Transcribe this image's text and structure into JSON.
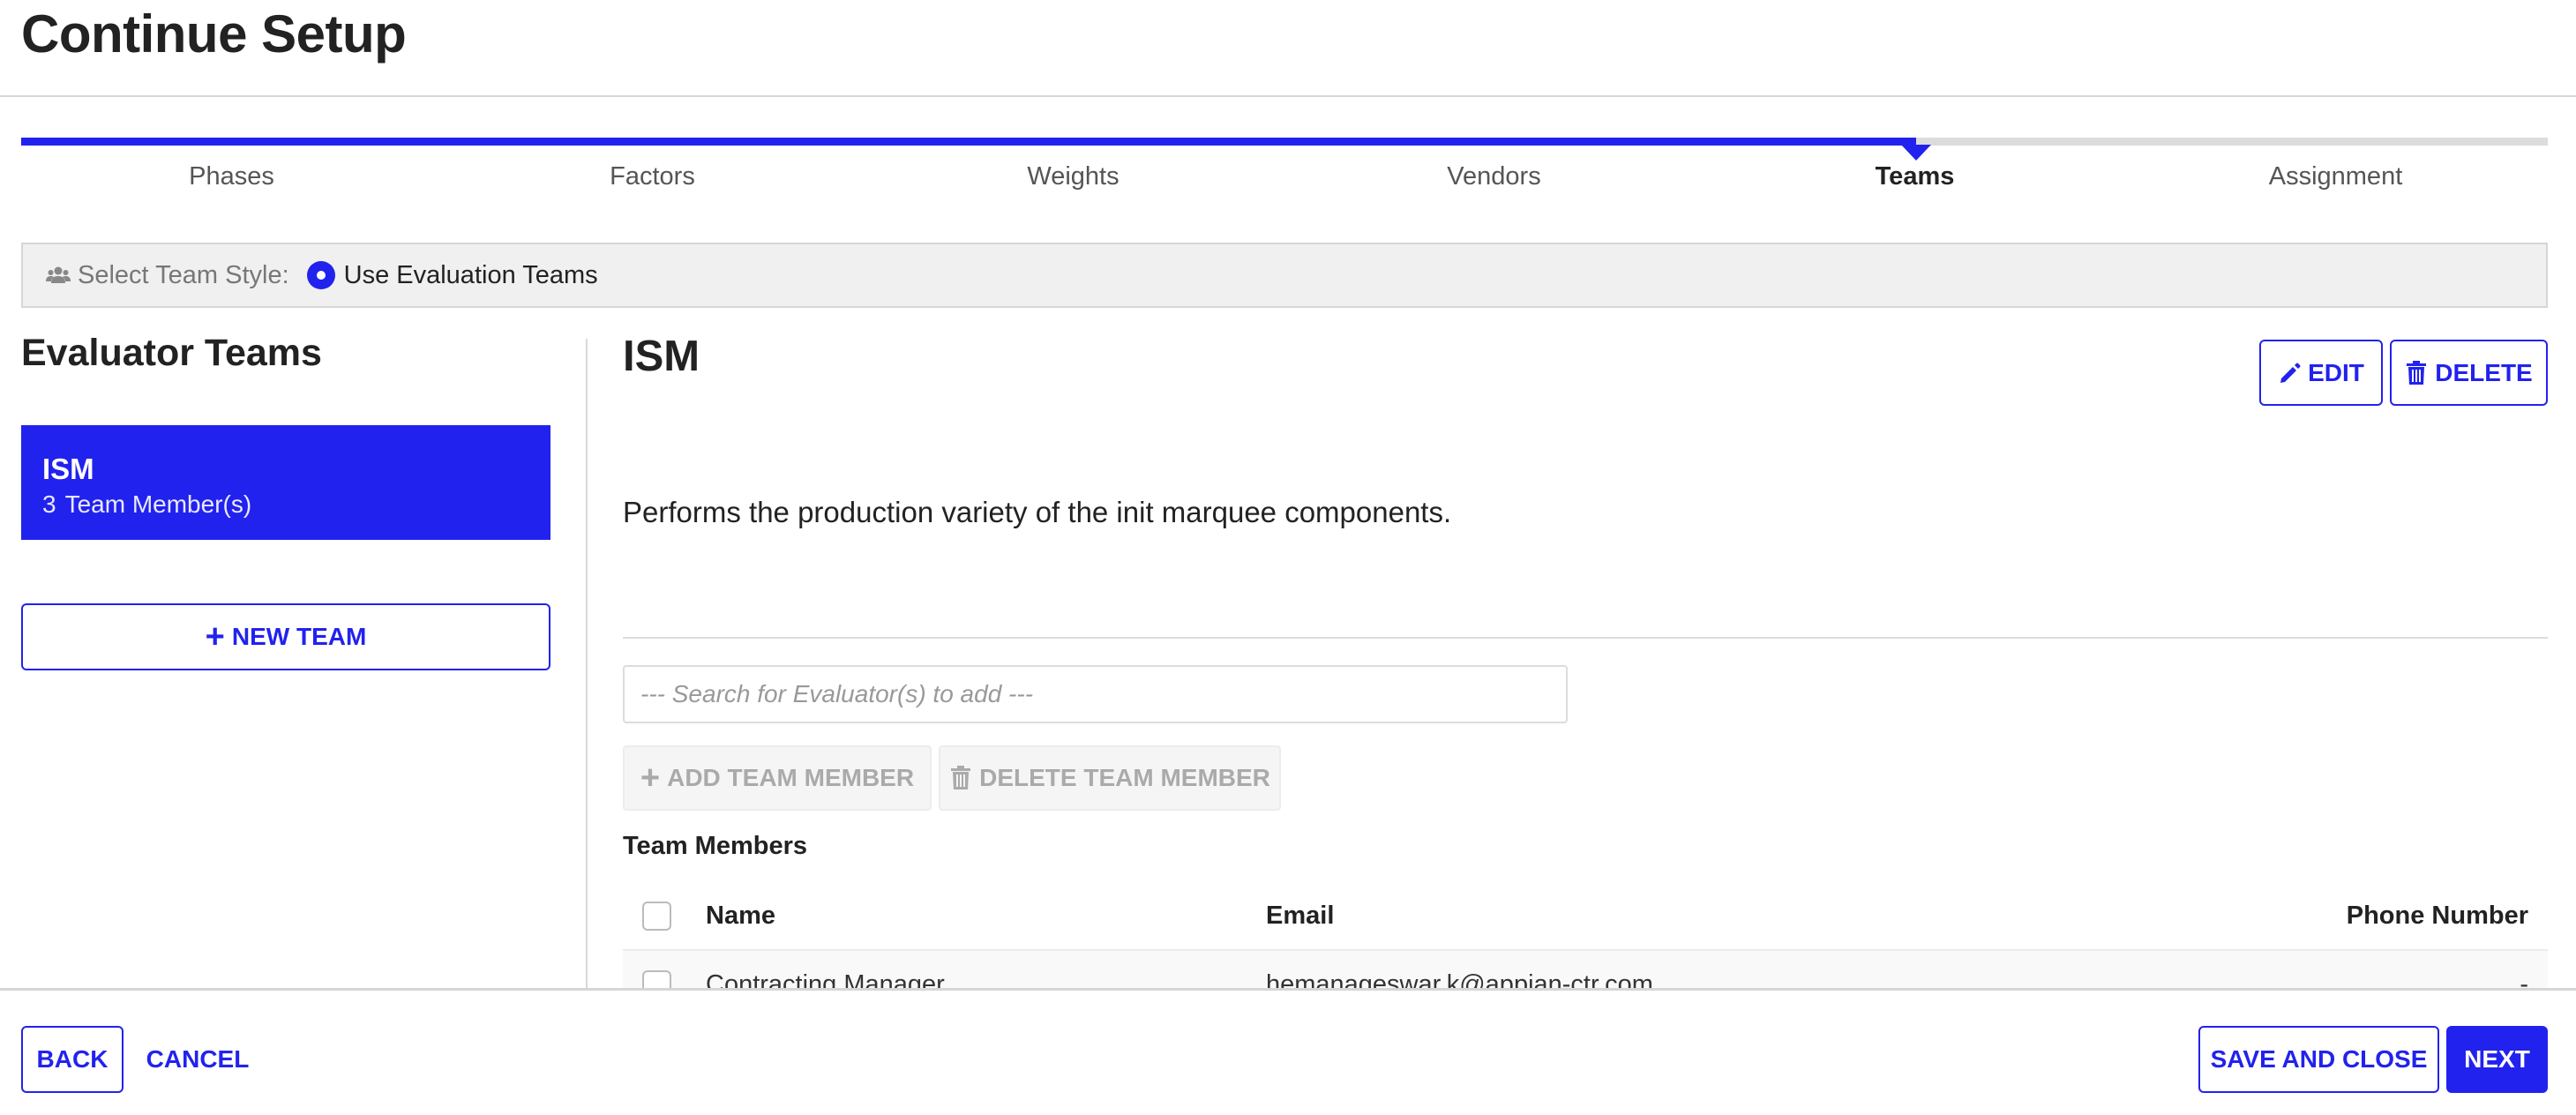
{
  "page": {
    "title": "Continue Setup"
  },
  "stepper": {
    "steps": [
      {
        "label": "Phases",
        "state": "complete"
      },
      {
        "label": "Factors",
        "state": "complete"
      },
      {
        "label": "Weights",
        "state": "complete"
      },
      {
        "label": "Vendors",
        "state": "complete"
      },
      {
        "label": "Teams",
        "state": "active"
      },
      {
        "label": "Assignment",
        "state": "upcoming"
      }
    ],
    "active_index": 4,
    "accent_color": "#2222ee"
  },
  "team_style": {
    "icon": "users-icon",
    "label": "Select Team Style:",
    "selected_option": "Use Evaluation Teams"
  },
  "left_panel": {
    "heading": "Evaluator Teams",
    "teams": [
      {
        "name": "ISM",
        "member_count": "3",
        "member_label": "Team Member(s)",
        "selected": true
      }
    ],
    "new_team_label": "NEW TEAM"
  },
  "detail": {
    "team_name": "ISM",
    "edit_label": "EDIT",
    "delete_label": "DELETE",
    "description": "Performs the production variety of the init marquee components.",
    "search_placeholder": "--- Search for Evaluator(s) to add ---",
    "search_value": "",
    "add_member_label": "ADD TEAM MEMBER",
    "delete_member_label": "DELETE TEAM MEMBER",
    "members_heading": "Team Members",
    "columns": {
      "name": "Name",
      "email": "Email",
      "phone": "Phone Number"
    },
    "members": [
      {
        "name": "Contracting Manager",
        "email": "hemanageswar.k@appian-ctr.com",
        "phone": "-"
      }
    ]
  },
  "footer": {
    "back_label": "BACK",
    "cancel_label": "CANCEL",
    "save_close_label": "SAVE AND CLOSE",
    "next_label": "NEXT"
  }
}
